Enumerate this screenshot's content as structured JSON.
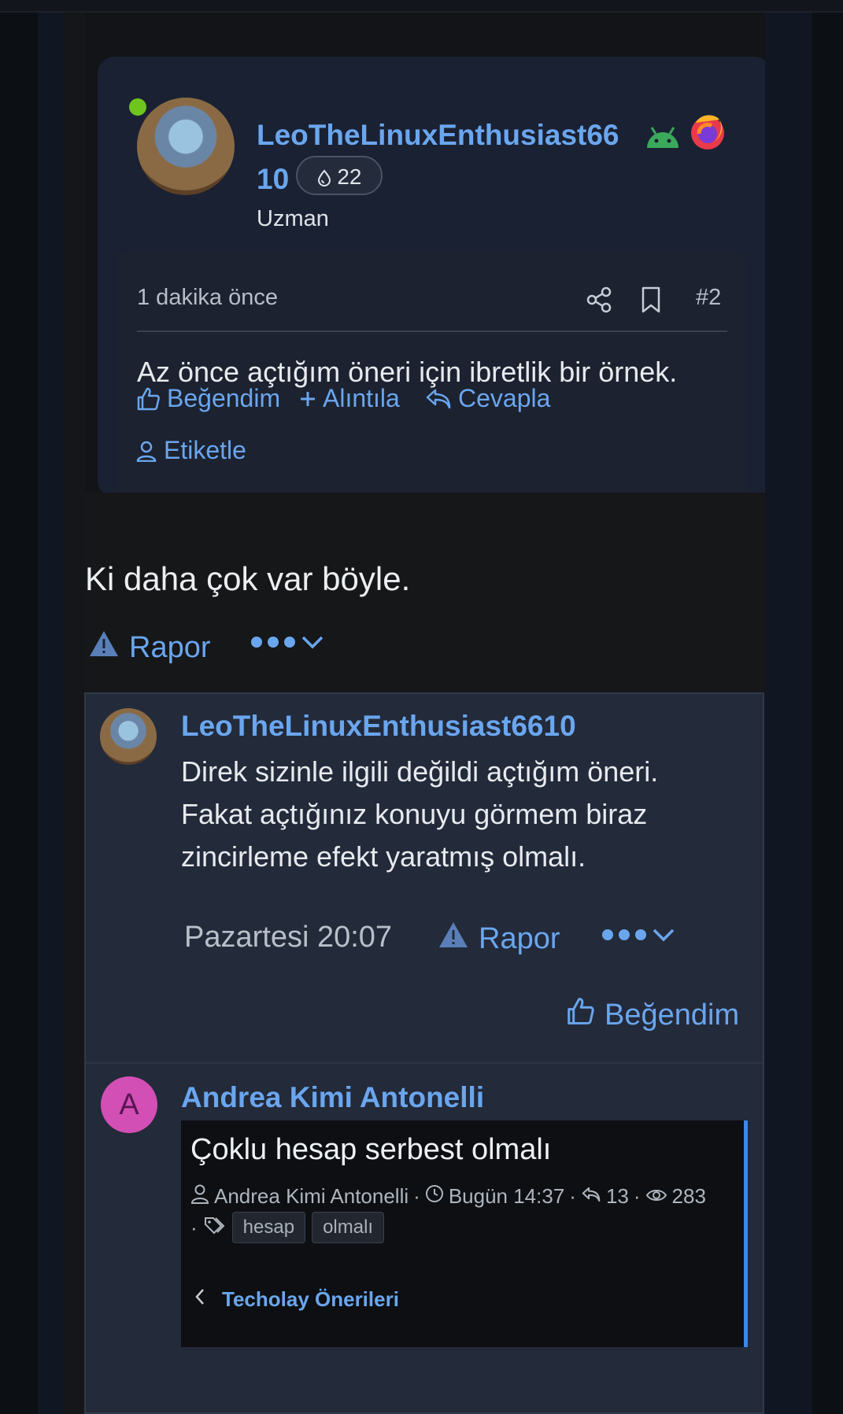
{
  "embed": {
    "username": "LeoTheLinuxEnthusiast6610",
    "reputation": "22",
    "role": "Uzman",
    "time": "1 dakika önce",
    "post_number": "#2",
    "text": "Az önce açtığım öneri için ibretlik bir örnek.",
    "actions": {
      "like": "Beğendim",
      "quote": "Alıntıla",
      "reply": "Cevapla",
      "tag": "Etiketle"
    }
  },
  "post": {
    "text": "Ki daha çok var böyle.",
    "report": "Rapor"
  },
  "comment": {
    "username": "LeoTheLinuxEnthusiast6610",
    "text": "Direk sizinle ilgili değildi açtığım öneri. Fakat açtığınız konuyu görmem biraz zincirleme efekt yaratmış olmalı.",
    "time": "Pazartesi 20:07",
    "report": "Rapor",
    "like": "Beğendim"
  },
  "reply": {
    "avatar_letter": "A",
    "username": "Andrea Kimi Antonelli",
    "topic": {
      "title": "Çoklu hesap serbest olmalı",
      "author": "Andrea Kimi Antonelli",
      "time": "Bugün 14:37",
      "replies": "13",
      "views": "283",
      "tags": [
        "hesap",
        "olmalı"
      ],
      "category": "Techolay Önerileri"
    }
  },
  "colors": {
    "accent": "#6aa6ee",
    "online": "#6ec51c",
    "avatar_a": "#d24fb5",
    "topic_border": "#3f86ea"
  },
  "icons": [
    "share-icon",
    "bookmark-icon",
    "thumbs-up-icon",
    "plus-icon",
    "reply-icon",
    "user-icon",
    "warning-icon",
    "more-icon",
    "chevron-down-icon",
    "clock-icon",
    "eye-icon",
    "tag-icon",
    "chevron-left-icon",
    "droplet-icon",
    "android-icon",
    "firefox-icon"
  ]
}
